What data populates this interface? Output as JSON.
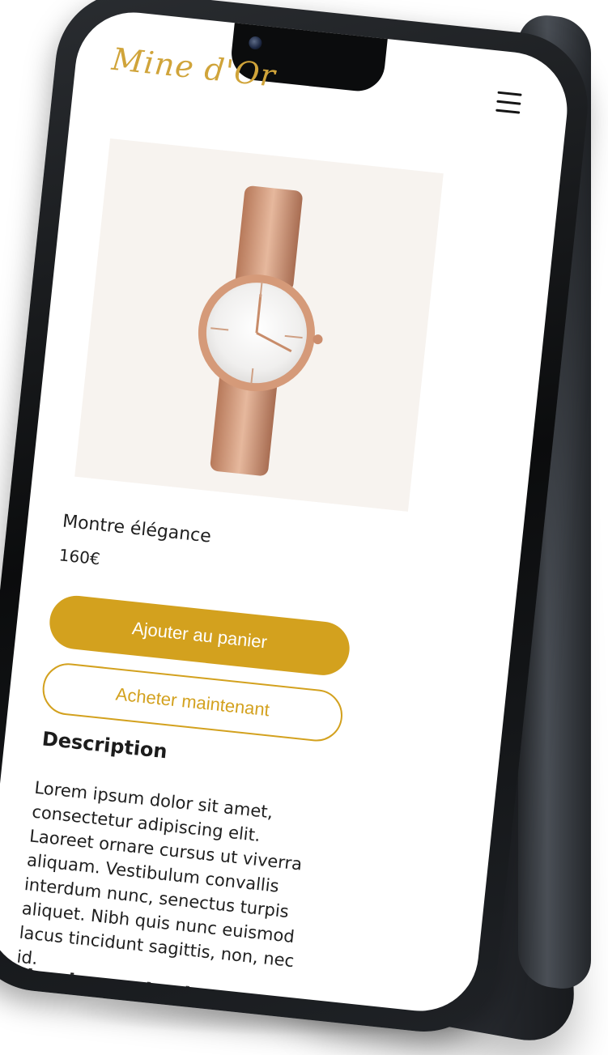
{
  "brand": {
    "logo_text": "Mine d'Or",
    "accent_color": "#d3a11e",
    "icons": {
      "menu": "hamburger-menu-icon",
      "camera": "camera-icon"
    }
  },
  "product": {
    "name": "Montre élégance",
    "price": "160€",
    "image_alt": "rose-gold mesh watch with white dial",
    "buttons": {
      "add_to_cart": "Ajouter au panier",
      "buy_now": "Acheter maintenant"
    }
  },
  "description": {
    "title": "Description",
    "text": "Lorem ipsum dolor sit amet, consectetur adipiscing elit. Laoreet ornare cursus ut viverra aliquam. Vestibulum convallis interdum nunc, senectus turpis aliquet. Nibh quis nunc euismod lacus tincidunt sagittis, non, nec id."
  },
  "shipping": {
    "title": "Livraisons et retours"
  }
}
